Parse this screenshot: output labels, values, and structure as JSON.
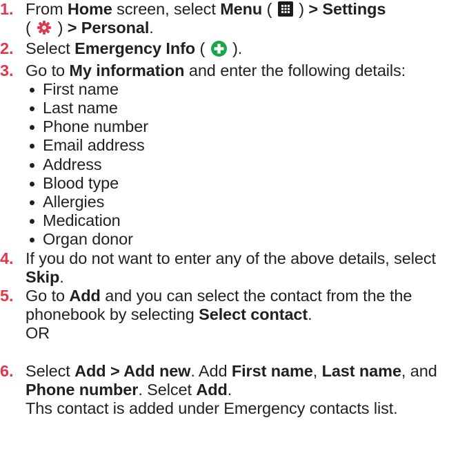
{
  "colors": {
    "step_number": "#e0364e",
    "text": "#231f20",
    "settings_icon": "#e0364e",
    "emergency_icon": "#1aa54b",
    "menu_icon_bg": "#1c1c1c"
  },
  "steps": [
    {
      "number": "1.",
      "parts": {
        "t1": "From ",
        "b1": "Home",
        "t2": " screen, select ",
        "b2": "Menu",
        "t3": " ( ",
        "icon1": "menu-grid-icon",
        "t4": " ) ",
        "b3": "> Settings",
        "t5": "( ",
        "icon2": "settings-gear-icon",
        "t6": " ) ",
        "b4": "> Personal",
        "t7": "."
      }
    },
    {
      "number": "2.",
      "parts": {
        "t1": "Select ",
        "b1": "Emergency Info",
        "t2": " ( ",
        "icon1": "emergency-plus-icon",
        "t3": " )."
      }
    },
    {
      "number": "3.",
      "parts": {
        "t1": "Go to ",
        "b1": "My information",
        "t2": " and enter the following details:"
      },
      "bullets": [
        "First name",
        "Last name",
        "Phone number",
        "Email address",
        "Address",
        "Blood type",
        "Allergies",
        "Medication",
        "Organ donor"
      ]
    },
    {
      "number": "4.",
      "parts": {
        "t1": "If you do not want to enter any of the above details, select ",
        "b1": "Skip",
        "t2": "."
      }
    },
    {
      "number": "5.",
      "parts": {
        "t1": "Go to ",
        "b1": "Add",
        "t2": " and you can select the contact from the the phonebook by selecting ",
        "b2": "Select contact",
        "t3": "."
      },
      "or_text": "OR"
    },
    {
      "number": "6.",
      "parts": {
        "t1": "Select ",
        "b1": "Add > Add new",
        "t2": ". Add ",
        "b2": "First name",
        "t3": ", ",
        "b3": "Last name",
        "t4": ", and ",
        "b4": "Phone number",
        "t5": ". Selcet ",
        "b5": "Add",
        "t6": ".",
        "t7": "Ths contact is added under Emergency contacts list."
      }
    }
  ]
}
